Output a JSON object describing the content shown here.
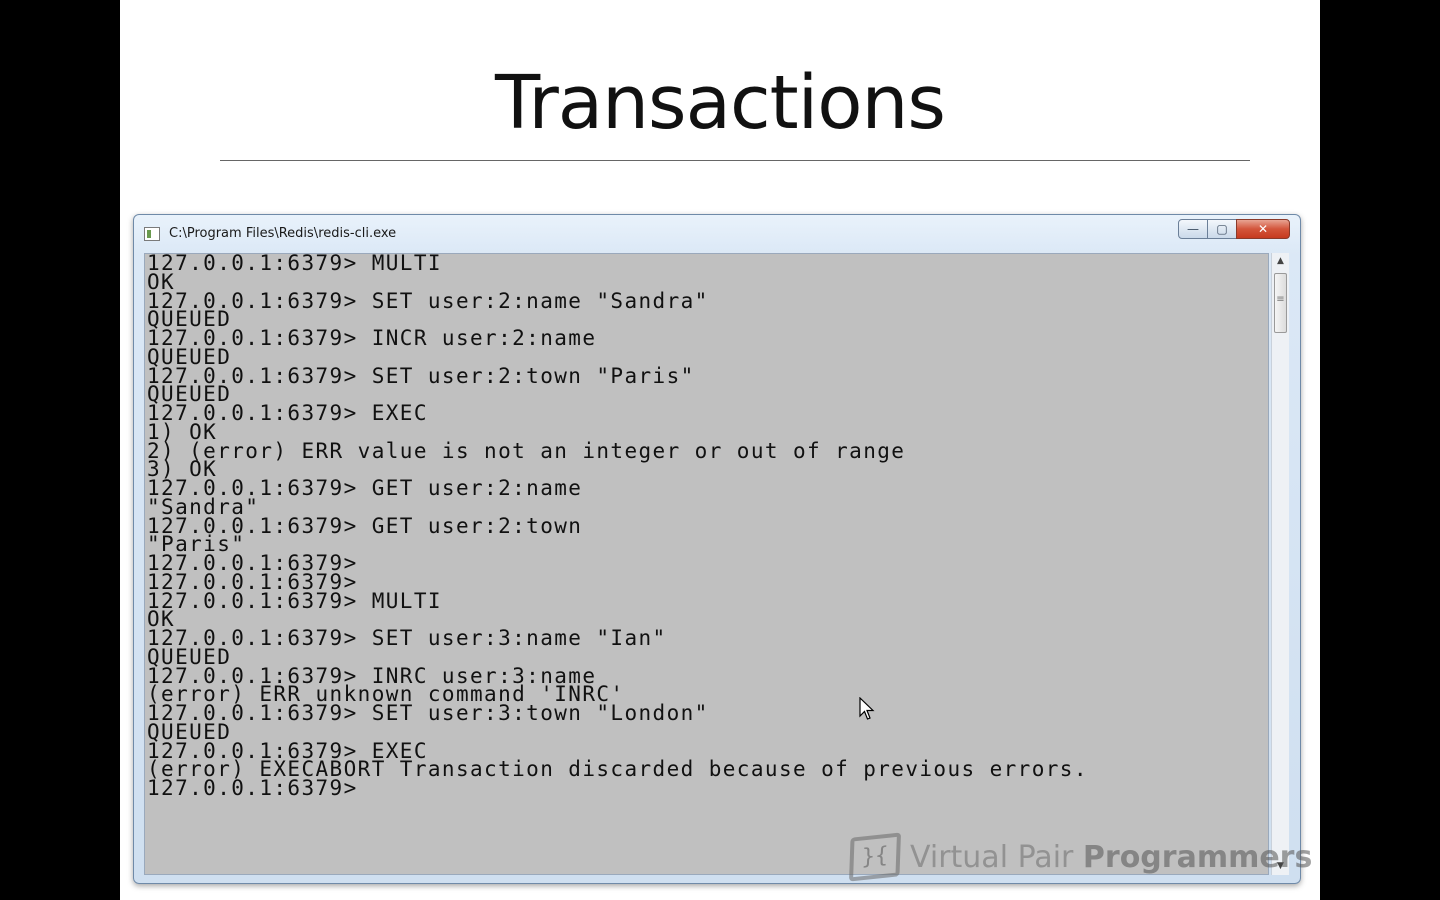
{
  "slide": {
    "title": "Transactions"
  },
  "window": {
    "title": "C:\\Program Files\\Redis\\redis-cli.exe",
    "buttons": {
      "minimize": "—",
      "maximize": "▢",
      "close": "✕"
    }
  },
  "console": {
    "lines": [
      "127.0.0.1:6379> MULTI",
      "OK",
      "127.0.0.1:6379> SET user:2:name \"Sandra\"",
      "QUEUED",
      "127.0.0.1:6379> INCR user:2:name",
      "QUEUED",
      "127.0.0.1:6379> SET user:2:town \"Paris\"",
      "QUEUED",
      "127.0.0.1:6379> EXEC",
      "1) OK",
      "2) (error) ERR value is not an integer or out of range",
      "3) OK",
      "127.0.0.1:6379> GET user:2:name",
      "\"Sandra\"",
      "127.0.0.1:6379> GET user:2:town",
      "\"Paris\"",
      "127.0.0.1:6379>",
      "127.0.0.1:6379>",
      "127.0.0.1:6379> MULTI",
      "OK",
      "127.0.0.1:6379> SET user:3:name \"Ian\"",
      "QUEUED",
      "127.0.0.1:6379> INRC user:3:name",
      "(error) ERR unknown command 'INRC'",
      "127.0.0.1:6379> SET user:3:town \"London\"",
      "QUEUED",
      "127.0.0.1:6379> EXEC",
      "(error) EXECABORT Transaction discarded because of previous errors.",
      "127.0.0.1:6379>"
    ]
  },
  "watermark": {
    "logo_glyph": "}{",
    "text_light": "Virtual Pair ",
    "text_bold": "Programmers"
  },
  "icons": {
    "app": "console-app-icon",
    "scroll_up": "▲",
    "scroll_down": "▼",
    "cursor": "mouse-pointer-icon"
  }
}
